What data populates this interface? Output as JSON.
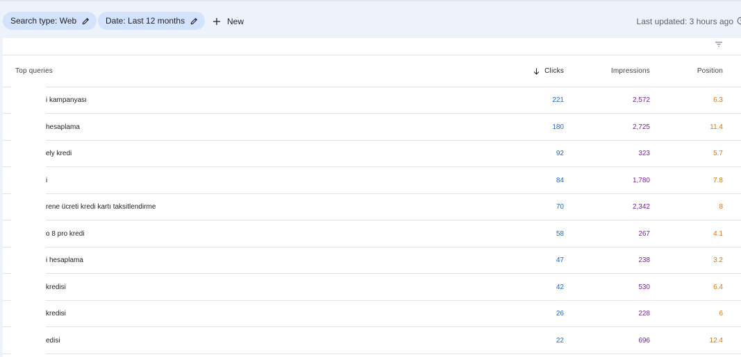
{
  "filters": {
    "search_type": "Search type: Web",
    "date": "Date: Last 12 months",
    "new_label": "New",
    "last_updated": "Last updated: 3 hours ago"
  },
  "table": {
    "columns": {
      "query": "Top queries",
      "clicks": "Clicks",
      "impressions": "Impressions",
      "position": "Position"
    },
    "rows": [
      {
        "query": "i kampanyası",
        "clicks": "221",
        "impressions": "2,572",
        "position": "6.3"
      },
      {
        "query": "hesaplama",
        "clicks": "180",
        "impressions": "2,725",
        "position": "11.4"
      },
      {
        "query": "ely kredi",
        "clicks": "92",
        "impressions": "323",
        "position": "5.7"
      },
      {
        "query": "i",
        "clicks": "84",
        "impressions": "1,780",
        "position": "7.8"
      },
      {
        "query": "rene ücreti kredi kartı taksitlendirme",
        "clicks": "70",
        "impressions": "2,342",
        "position": "8"
      },
      {
        "query": "o 8 pro kredi",
        "clicks": "58",
        "impressions": "267",
        "position": "4.1"
      },
      {
        "query": "i hesaplama",
        "clicks": "47",
        "impressions": "238",
        "position": "3.2"
      },
      {
        "query": "kredisi",
        "clicks": "42",
        "impressions": "530",
        "position": "6.4"
      },
      {
        "query": "kredisi",
        "clicks": "26",
        "impressions": "228",
        "position": "6"
      },
      {
        "query": "edisi",
        "clicks": "22",
        "impressions": "696",
        "position": "12.4"
      }
    ]
  },
  "icons": {
    "edit": "pencil-icon",
    "add": "plus-icon",
    "sort": "arrow-down-icon",
    "filter": "filter-icon",
    "history": "clock-icon"
  },
  "colors": {
    "clicks": "#1967d2",
    "impressions": "#7b1fa2",
    "position": "#e37400",
    "chip_bg": "#d3e3fd"
  }
}
